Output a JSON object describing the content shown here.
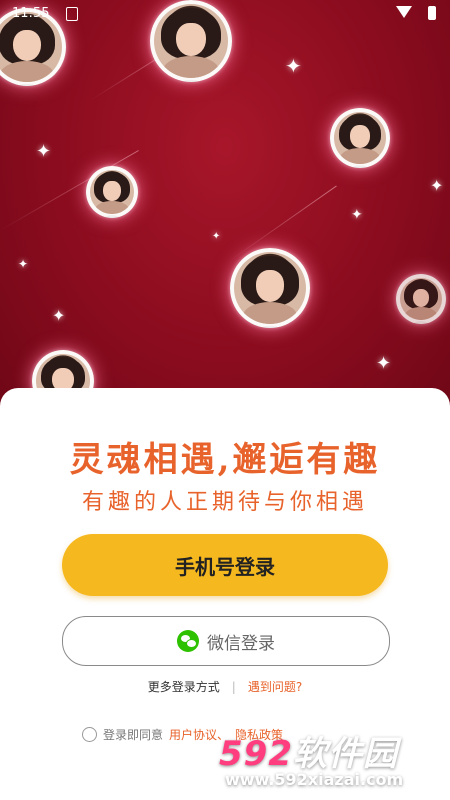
{
  "status_bar": {
    "time": "11:55"
  },
  "login_sheet": {
    "headline": "灵魂相遇,邂逅有趣",
    "subline": "有趣的人正期待与你相遇",
    "phone_login_label": "手机号登录",
    "wechat_login_label": "微信登录",
    "more_login_label": "更多登录方式",
    "problem_label": "遇到问题?",
    "agreement_prefix": "登录即同意",
    "user_agreement_label": "用户协议、",
    "privacy_label": "隐私政策"
  },
  "watermark": {
    "brand_num": "592",
    "brand_text": "软件园",
    "url": "www.592xiazai.com"
  },
  "colors": {
    "accent": "#e8632b",
    "primary_button": "#f6b81f",
    "hero_bg": "#8e0d1e",
    "wechat": "#2dc100"
  },
  "icons": [
    "sim-icon",
    "wifi-icon",
    "battery-icon",
    "wechat-icon",
    "radio-icon",
    "sparkle-icon"
  ]
}
